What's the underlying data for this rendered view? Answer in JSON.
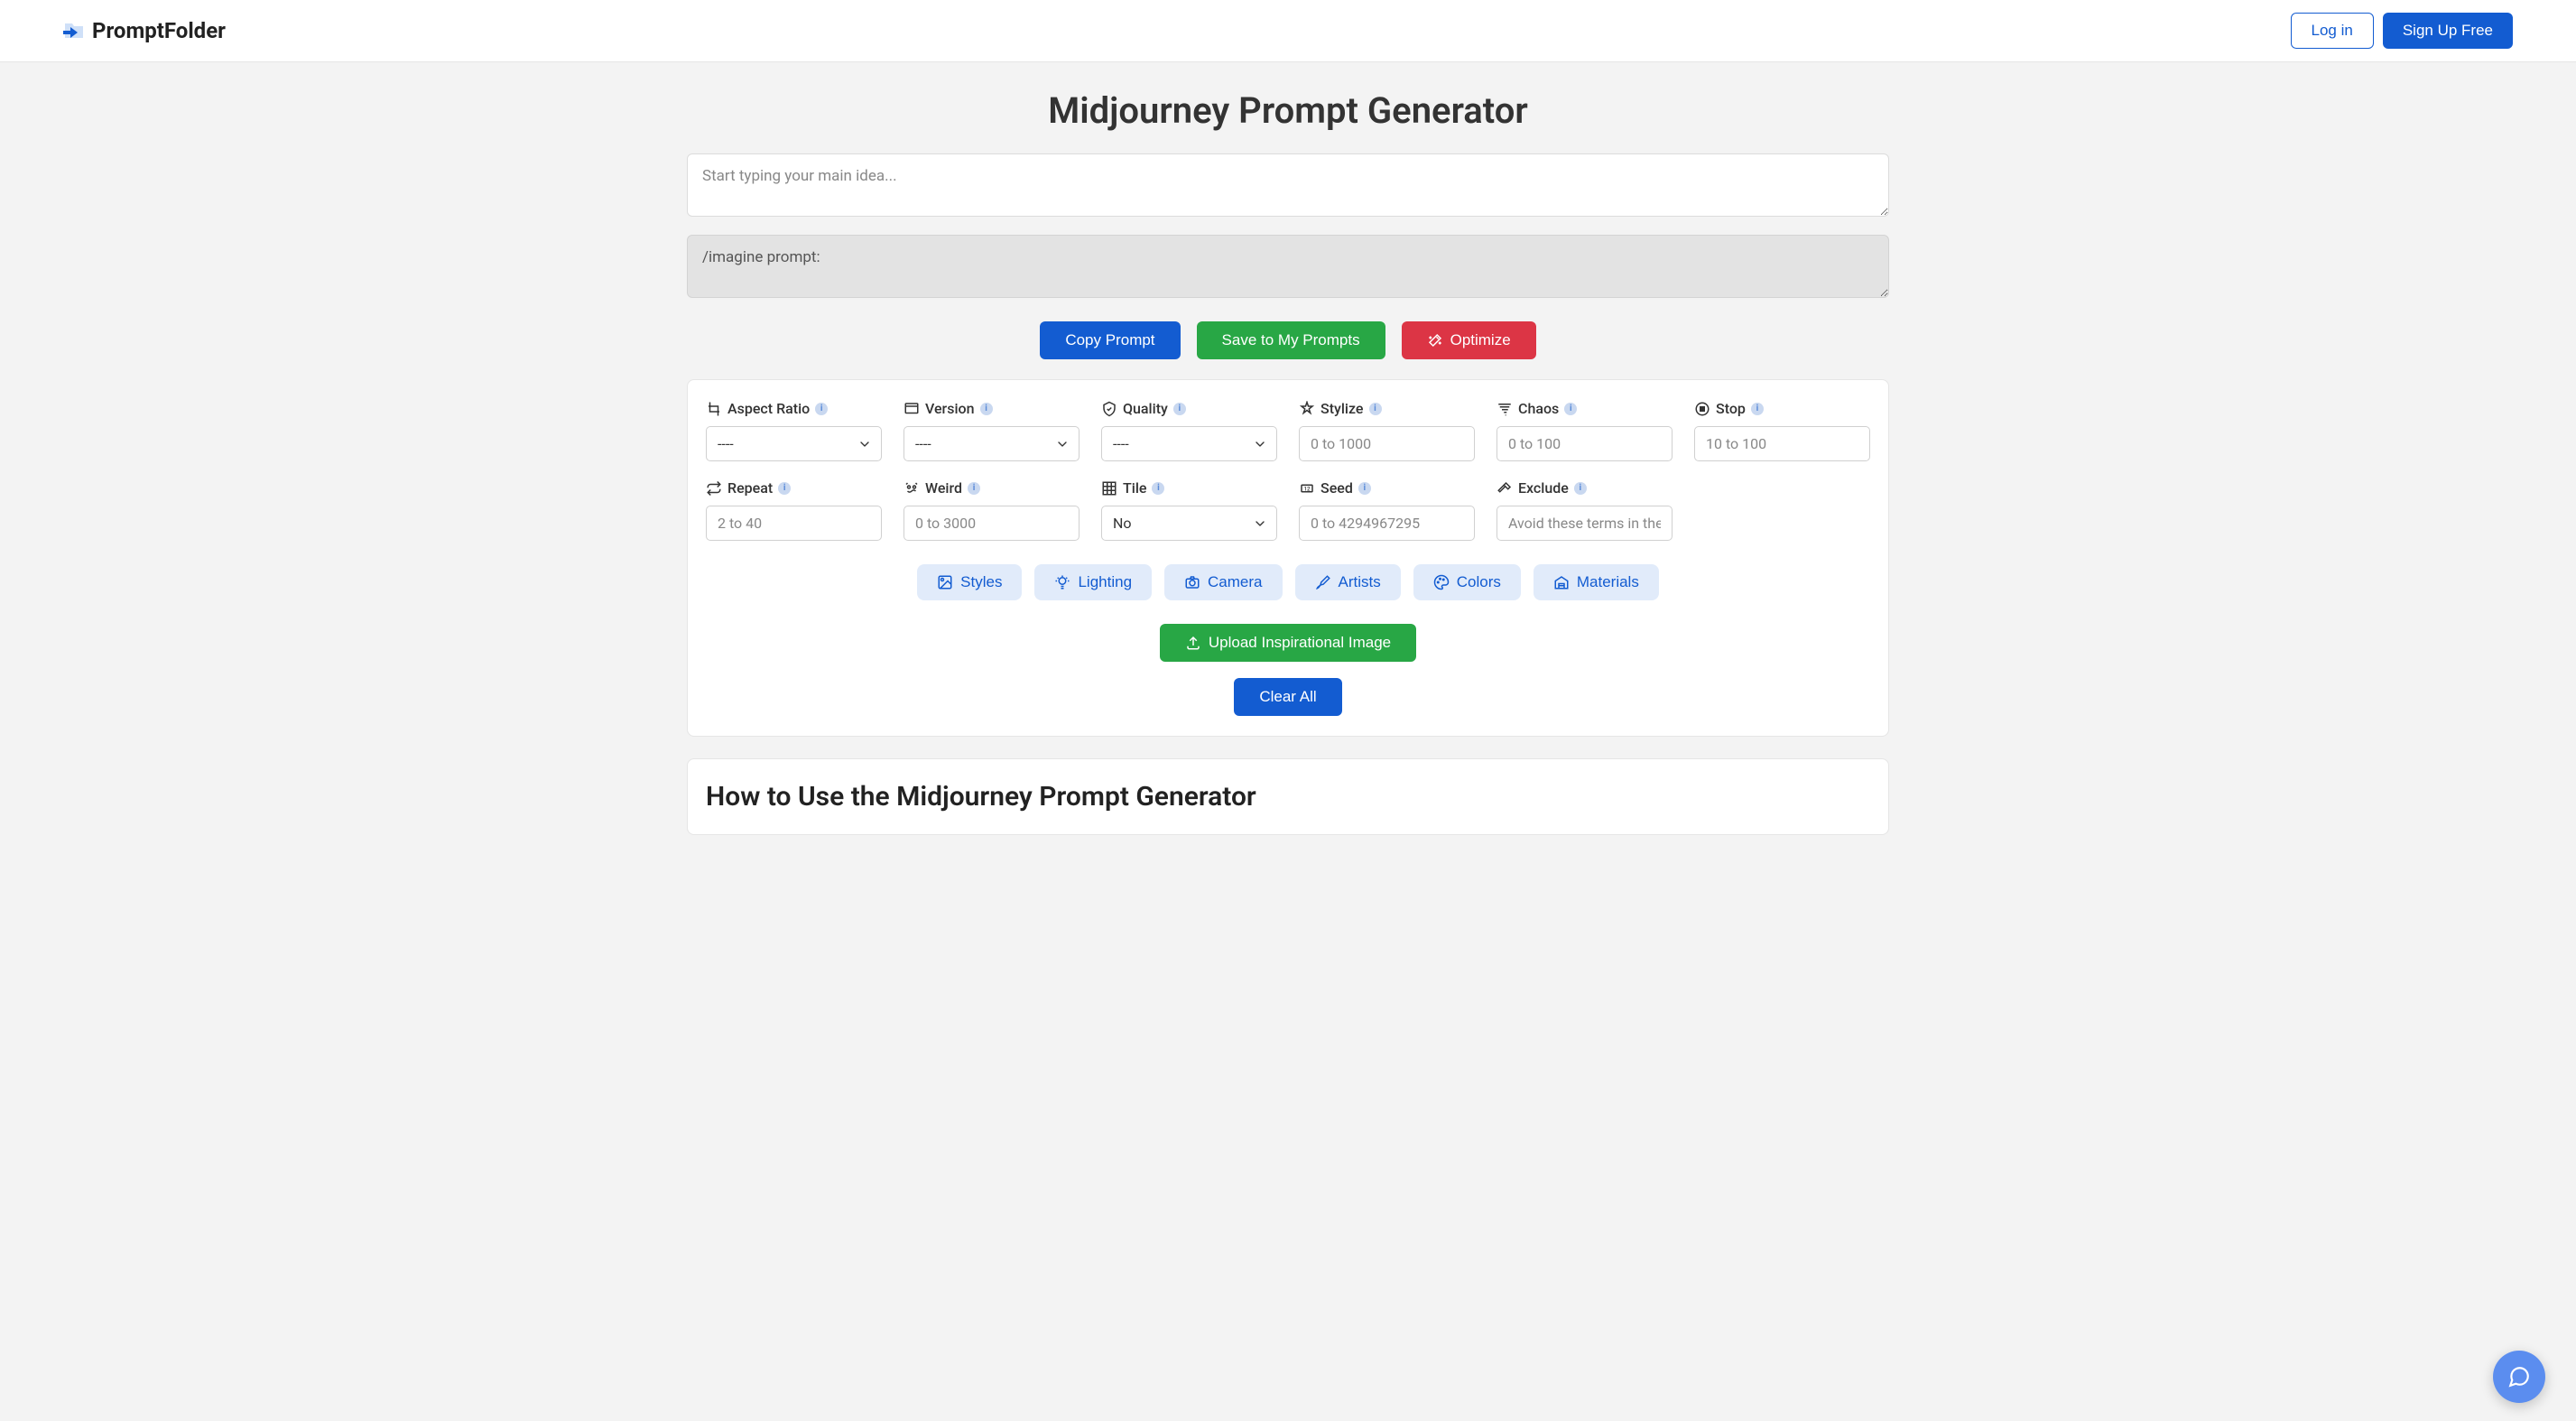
{
  "header": {
    "brand": "PromptFolder",
    "login": "Log in",
    "signup": "Sign Up Free"
  },
  "title": "Midjourney Prompt Generator",
  "mainInput": {
    "placeholder": "Start typing your main idea..."
  },
  "output": {
    "value": "/imagine prompt:"
  },
  "actions": {
    "copy": "Copy Prompt",
    "save": "Save to My Prompts",
    "optimize": "Optimize"
  },
  "options": {
    "aspect": {
      "label": "Aspect Ratio",
      "default": "----"
    },
    "version": {
      "label": "Version",
      "default": "----"
    },
    "quality": {
      "label": "Quality",
      "default": "----"
    },
    "stylize": {
      "label": "Stylize",
      "placeholder": "0 to 1000"
    },
    "chaos": {
      "label": "Chaos",
      "placeholder": "0 to 100"
    },
    "stop": {
      "label": "Stop",
      "placeholder": "10 to 100"
    },
    "repeat": {
      "label": "Repeat",
      "placeholder": "2 to 40"
    },
    "weird": {
      "label": "Weird",
      "placeholder": "0 to 3000"
    },
    "tile": {
      "label": "Tile",
      "default": "No"
    },
    "seed": {
      "label": "Seed",
      "placeholder": "0 to 4294967295"
    },
    "exclude": {
      "label": "Exclude",
      "placeholder": "Avoid these terms in the"
    }
  },
  "chips": {
    "styles": "Styles",
    "lighting": "Lighting",
    "camera": "Camera",
    "artists": "Artists",
    "colors": "Colors",
    "materials": "Materials"
  },
  "upload": "Upload Inspirational Image",
  "clear": "Clear All",
  "howto": "How to Use the Midjourney Prompt Generator"
}
